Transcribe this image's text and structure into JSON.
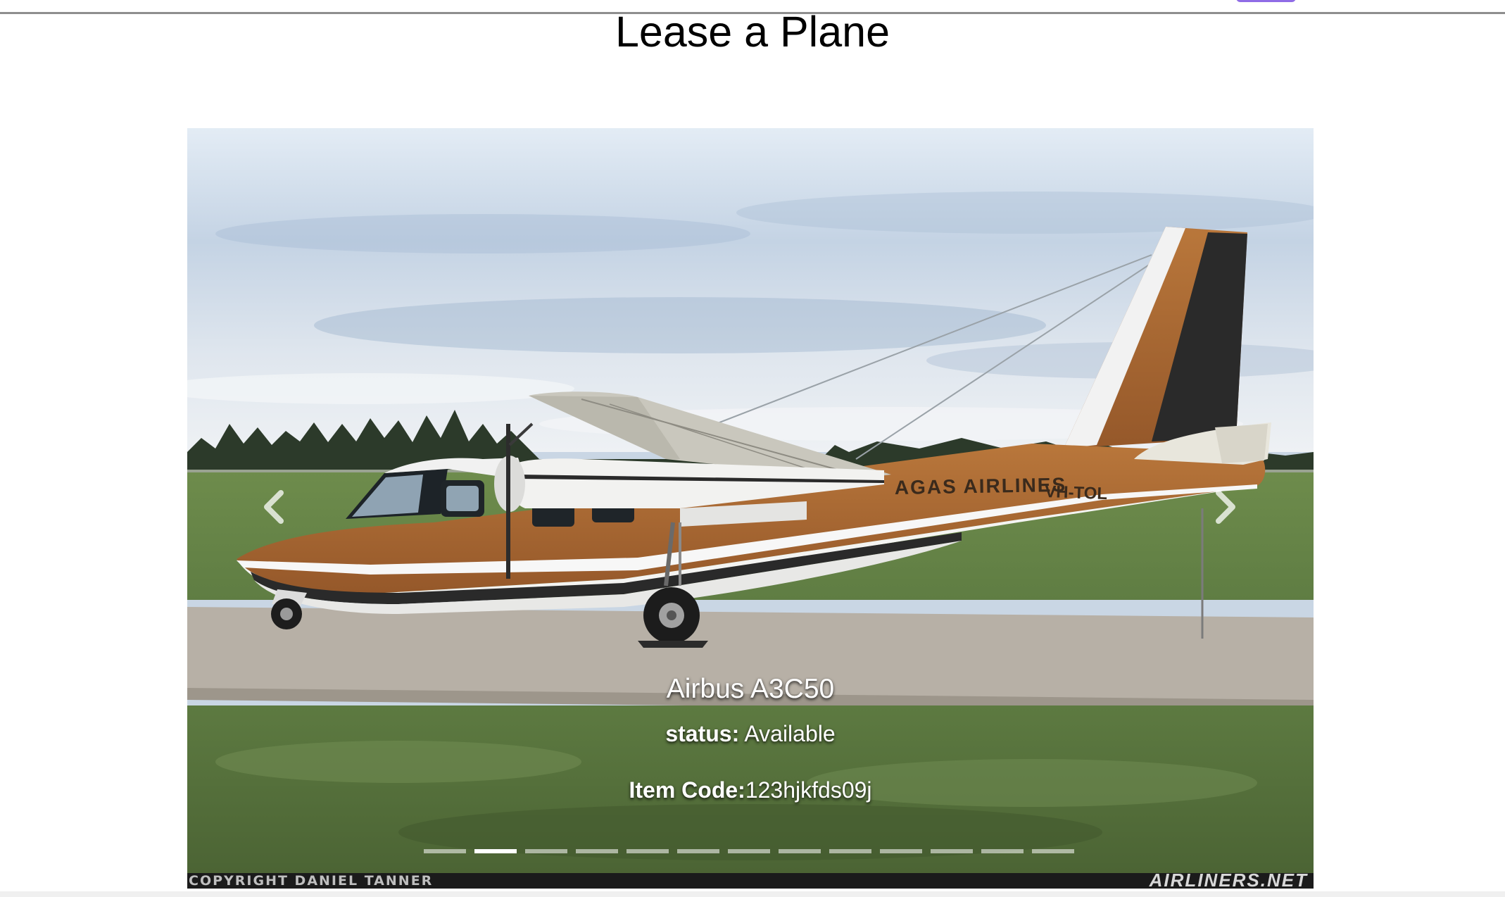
{
  "page": {
    "title": "Lease a Plane"
  },
  "carousel": {
    "active_index": 1,
    "indicator_count": 13,
    "slide": {
      "name": "Airbus A3C50",
      "status_label": "status:",
      "status_value": "Available",
      "code_label": "Item Code:",
      "code_value": "123hjkfds09j",
      "photo": {
        "livery_text": "AGAS AIRLINES",
        "registration": "VH-TOL",
        "credit_left": "COPYRIGHT DANIEL TANNER",
        "credit_right": "AIRLINERS.NET"
      }
    },
    "prev_icon": "chevron-left-icon",
    "next_icon": "chevron-right-icon"
  },
  "colors": {
    "accent_pill": "#8f6ce6",
    "plane_brown": "#a8672f",
    "plane_dark": "#2a2a2a"
  }
}
